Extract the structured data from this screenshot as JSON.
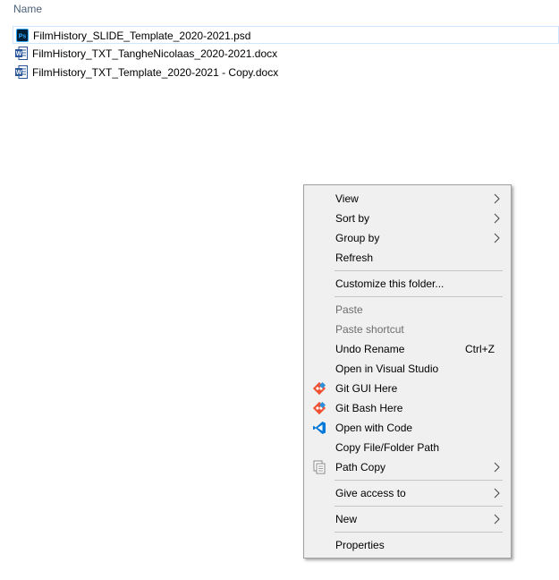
{
  "header": {
    "name_column": "Name"
  },
  "files": [
    {
      "name": "FilmHistory_SLIDE_Template_2020-2021.psd",
      "icon": "photoshop-file-icon",
      "selected": true
    },
    {
      "name": "FilmHistory_TXT_TangheNicolaas_2020-2021.docx",
      "icon": "word-file-icon",
      "selected": false
    },
    {
      "name": "FilmHistory_TXT_Template_2020-2021 - Copy.docx",
      "icon": "word-file-icon",
      "selected": false
    }
  ],
  "context_menu": {
    "items": [
      {
        "label": "View",
        "submenu": true
      },
      {
        "label": "Sort by",
        "submenu": true
      },
      {
        "label": "Group by",
        "submenu": true
      },
      {
        "label": "Refresh"
      },
      {
        "label": "Customize this folder..."
      },
      {
        "label": "Paste",
        "disabled": true
      },
      {
        "label": "Paste shortcut",
        "disabled": true
      },
      {
        "label": "Undo Rename",
        "shortcut": "Ctrl+Z"
      },
      {
        "label": "Open in Visual Studio"
      },
      {
        "label": "Git GUI Here",
        "icon": "git-icon"
      },
      {
        "label": "Git Bash Here",
        "icon": "git-icon"
      },
      {
        "label": "Open with Code",
        "icon": "vscode-icon"
      },
      {
        "label": "Copy File/Folder Path"
      },
      {
        "label": "Path Copy",
        "icon": "path-copy-icon",
        "submenu": true
      },
      {
        "label": "Give access to",
        "submenu": true
      },
      {
        "label": "New",
        "submenu": true
      },
      {
        "label": "Properties"
      }
    ]
  },
  "colors": {
    "menu_bg": "#f0f0f0",
    "selection_border": "#cde8ff",
    "header_text": "#4c607a",
    "disabled_text": "#6d6d6d"
  }
}
